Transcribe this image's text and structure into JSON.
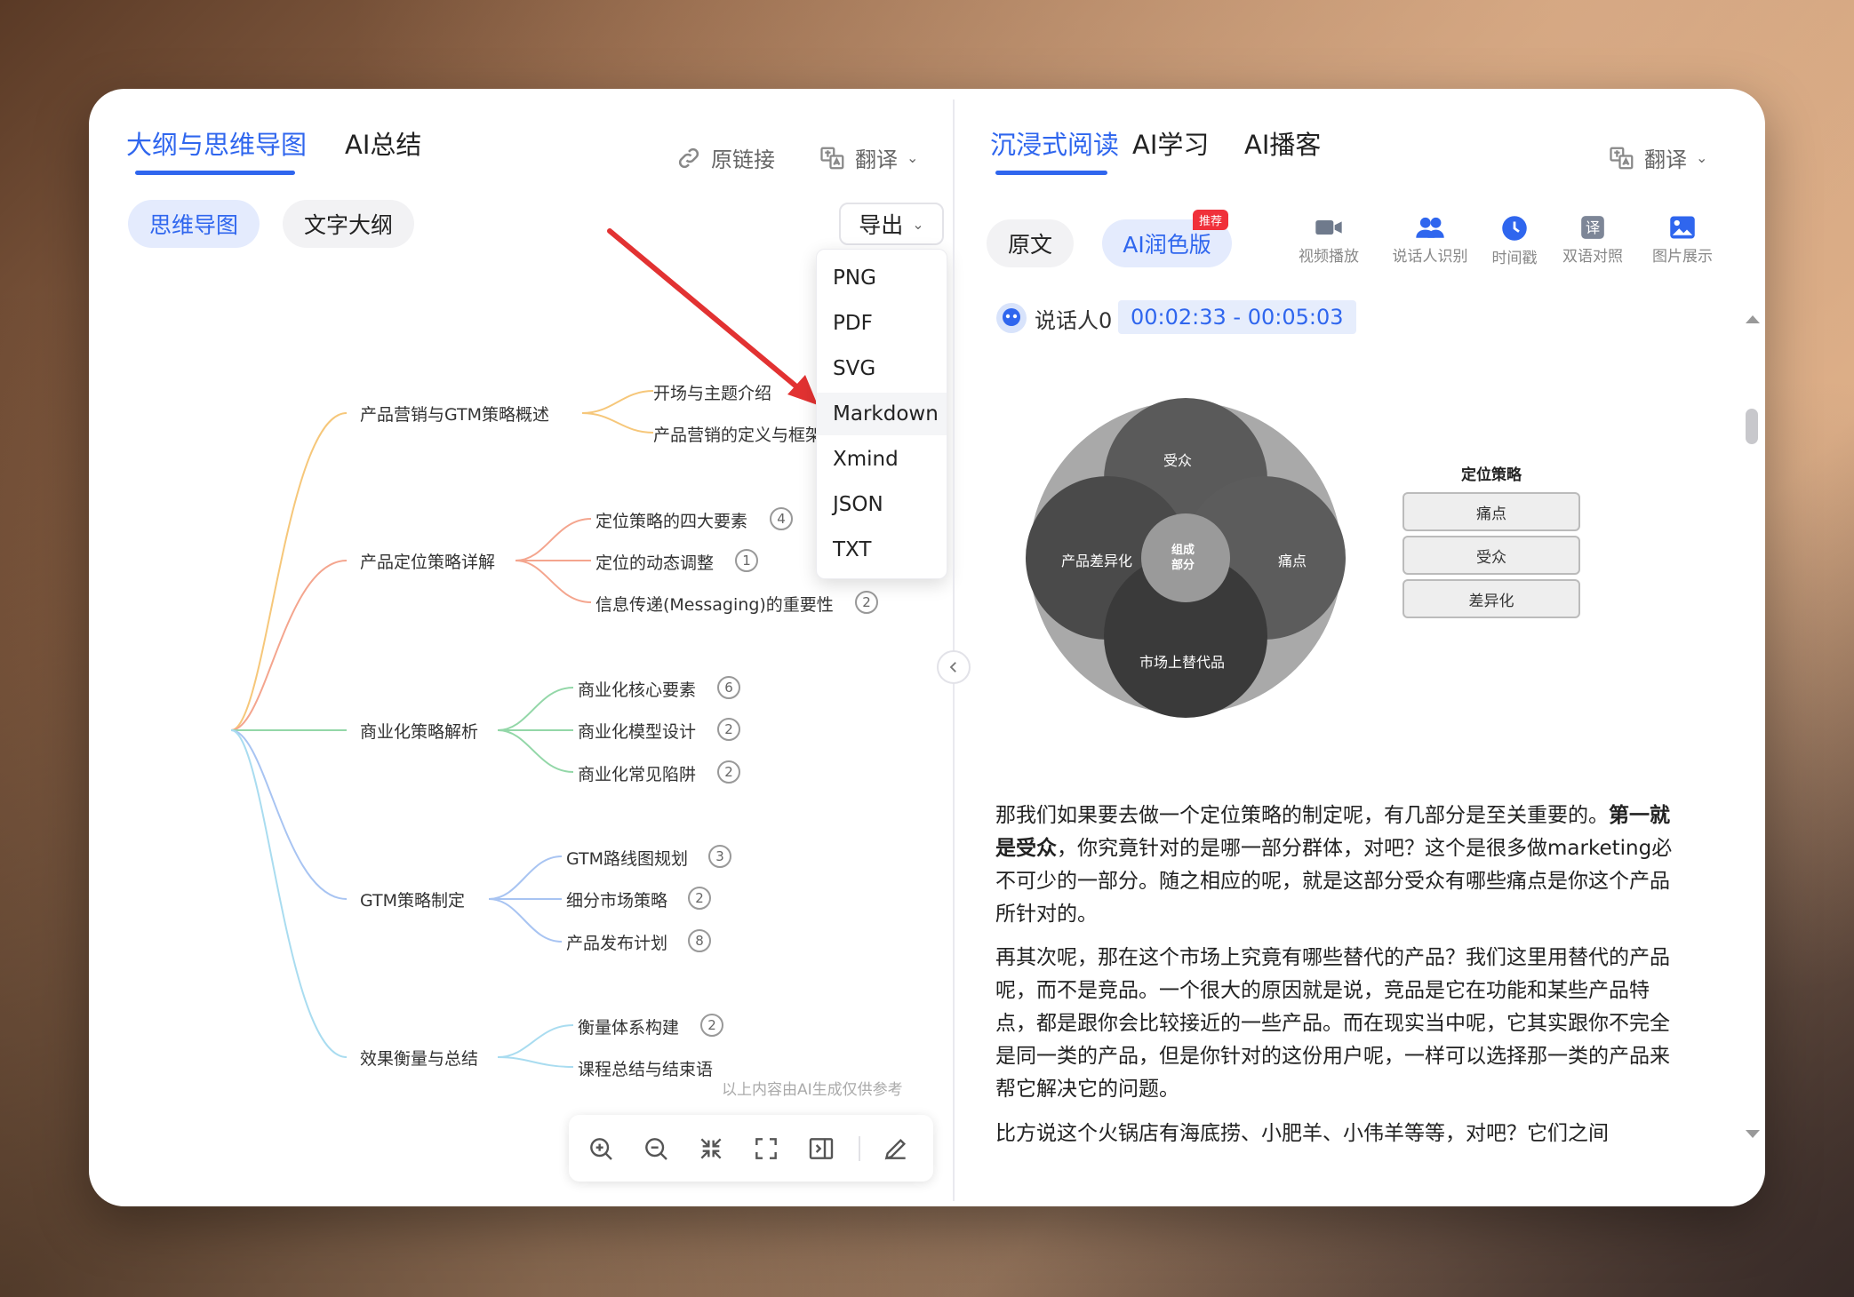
{
  "left_panel": {
    "tabs": [
      {
        "label": "大纲与思维导图",
        "active": true
      },
      {
        "label": "AI总结",
        "active": false
      }
    ],
    "tools": {
      "original_link": "原链接",
      "translate": "翻译"
    },
    "view_toggle": [
      {
        "label": "思维导图",
        "active": true
      },
      {
        "label": "文字大纲",
        "active": false
      }
    ],
    "export": {
      "label": "导出",
      "options": [
        "PNG",
        "PDF",
        "SVG",
        "Markdown",
        "Xmind",
        "JSON",
        "TXT"
      ],
      "hovered": "Markdown"
    },
    "mindmap": {
      "branches": [
        {
          "label": "产品营销与GTM策略概述",
          "color": "#f6c77a",
          "children": [
            {
              "label": "开场与主题介绍",
              "count": ""
            },
            {
              "label": "产品营销的定义与框架",
              "count": ""
            }
          ]
        },
        {
          "label": "产品定位策略详解",
          "color": "#f4a58e",
          "children": [
            {
              "label": "定位策略的四大要素",
              "count": "4"
            },
            {
              "label": "定位的动态调整",
              "count": "1"
            },
            {
              "label": "信息传递(Messaging)的重要性",
              "count": "2"
            }
          ]
        },
        {
          "label": "商业化策略解析",
          "color": "#93d7a8",
          "children": [
            {
              "label": "商业化核心要素",
              "count": "6"
            },
            {
              "label": "商业化模型设计",
              "count": "2"
            },
            {
              "label": "商业化常见陷阱",
              "count": "2"
            }
          ]
        },
        {
          "label": "GTM策略制定",
          "color": "#a8c4f2",
          "children": [
            {
              "label": "GTM路线图规划",
              "count": "3"
            },
            {
              "label": "细分市场策略",
              "count": "2"
            },
            {
              "label": "产品发布计划",
              "count": "8"
            }
          ]
        },
        {
          "label": "效果衡量与总结",
          "color": "#a9dcf0",
          "children": [
            {
              "label": "衡量体系构建",
              "count": "2"
            },
            {
              "label": "课程总结与结束语",
              "count": ""
            }
          ]
        }
      ]
    },
    "footnote": "以上内容由AI生成仅供参考",
    "zoombar": [
      "zoom-in-icon",
      "zoom-out-icon",
      "collapse-icon",
      "fullscreen-icon",
      "sidebar-icon",
      "edit-icon"
    ]
  },
  "right_panel": {
    "tabs": [
      {
        "label": "沉浸式阅读",
        "active": true
      },
      {
        "label": "AI学习",
        "active": false
      },
      {
        "label": "AI播客",
        "active": false
      }
    ],
    "translate": "翻译",
    "mode_toggle": [
      {
        "label": "原文",
        "active": false
      },
      {
        "label": "AI润色版",
        "active": true
      }
    ],
    "recommend_badge": "推荐",
    "tools": [
      {
        "label": "视频播放",
        "icon": "video-icon"
      },
      {
        "label": "说话人识别",
        "icon": "speaker-id-icon"
      },
      {
        "label": "时间戳",
        "icon": "clock-icon"
      },
      {
        "label": "双语对照",
        "icon": "bilingual-icon"
      },
      {
        "label": "图片展示",
        "icon": "image-icon"
      }
    ],
    "speaker": "说话人0",
    "timestamp": "00:02:33 - 00:05:03",
    "diagram": {
      "circles": [
        "受众",
        "产品差异化",
        "痛点",
        "市场上替代品"
      ],
      "center": "组成\n部分",
      "legend_title": "定位策略",
      "legend_items": [
        "痛点",
        "受众",
        "差异化"
      ]
    },
    "paragraphs": {
      "p1_pre": "那我们如果要去做一个定位策略的制定呢，有几部分是至关重要的。",
      "p1_bold": "第一就是受众",
      "p1_post": "，你究竟针对的是哪一部分群体，对吧？这个是很多做marketing必不可少的一部分。随之相应的呢，就是这部分受众有哪些痛点是你这个产品所针对的。",
      "p2": "再其次呢，那在这个市场上究竟有哪些替代的产品？我们这里用替代的产品呢，而不是竞品。一个很大的原因就是说，竞品是它在功能和某些产品特点，都是跟你会比较接近的一些产品。而在现实当中呢，它其实跟你不完全是同一类的产品，但是你针对的这份用户呢，一样可以选择那一类的产品来帮它解决它的问题。",
      "p3": "比方说这个火锅店有海底捞、小肥羊、小伟羊等等，对吧？它们之间"
    }
  }
}
